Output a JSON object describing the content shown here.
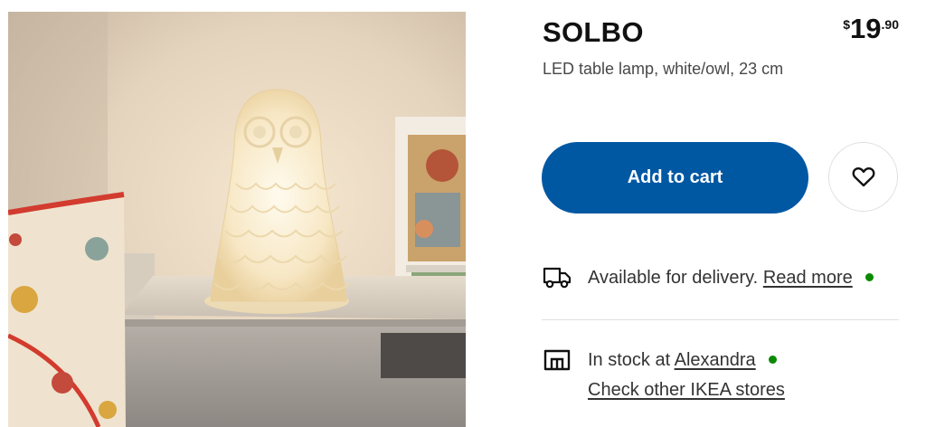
{
  "product": {
    "name": "SOLBO",
    "description": "LED table lamp, white/owl, 23 cm",
    "image_alt": "owl-lamp-photo"
  },
  "price": {
    "currency": "$",
    "integer": "19",
    "decimal": ".90"
  },
  "actions": {
    "add_to_cart": "Add to cart",
    "favourite_icon": "heart-icon"
  },
  "delivery": {
    "icon": "truck-icon",
    "text": "Available for delivery.",
    "link": "Read more",
    "status_color": "#0a8a00"
  },
  "stock": {
    "icon": "store-icon",
    "text": "In stock at",
    "store_link": "Alexandra",
    "status_color": "#0a8a00",
    "other_stores_link": "Check other IKEA stores"
  },
  "colors": {
    "primary_button": "#0058a3",
    "available": "#0a8a00"
  }
}
